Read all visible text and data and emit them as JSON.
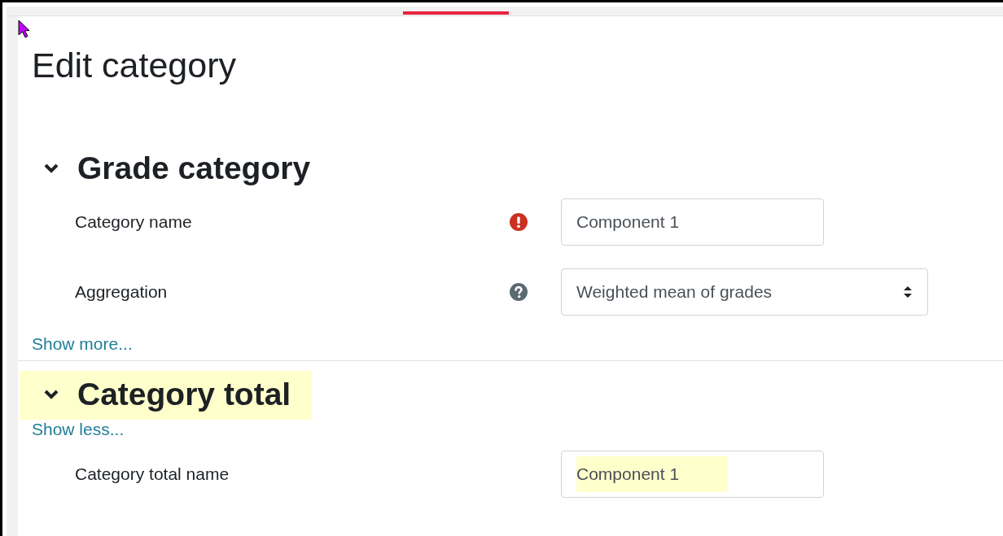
{
  "title": "Edit category",
  "sections": [
    {
      "title": "Grade category",
      "expanded": true,
      "highlighted": false,
      "link_after": "Show more...",
      "fields": [
        {
          "label": "Category name",
          "required": true,
          "help": false,
          "kind": "input",
          "value": "Component 1",
          "highlighted": false
        },
        {
          "label": "Aggregation",
          "required": false,
          "help": true,
          "kind": "select",
          "value": "Weighted mean of grades",
          "highlighted": false
        }
      ]
    },
    {
      "title": "Category total",
      "expanded": true,
      "highlighted": true,
      "link_before": "Show less...",
      "fields": [
        {
          "label": "Category total name",
          "required": false,
          "help": false,
          "kind": "input",
          "value": "Component 1",
          "highlighted": true
        }
      ]
    }
  ]
}
